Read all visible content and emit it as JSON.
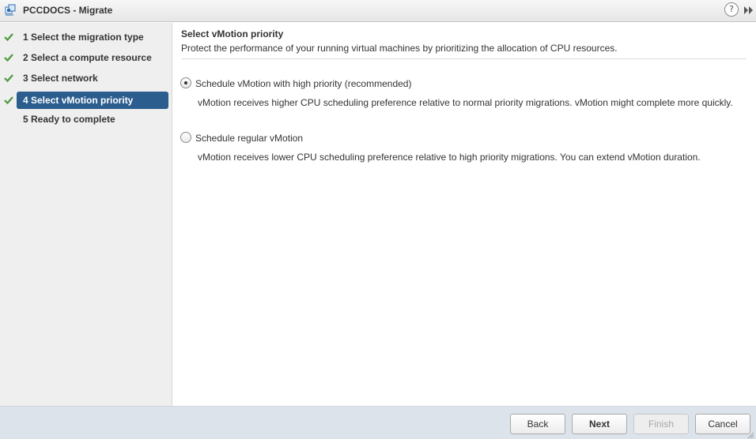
{
  "window": {
    "title": "PCCDOCS - Migrate",
    "help_glyph": "?",
    "icons": {
      "app": "vm-migrate-icon",
      "help": "help-icon",
      "expand": "expand-icon"
    }
  },
  "colors": {
    "active_step": "#2b5d8e",
    "check": "#4a9a3b",
    "footer": "#dde3ea",
    "sidebar": "#efefef"
  },
  "steps": [
    {
      "label": "1  Select the migration type",
      "completed": true,
      "active": false
    },
    {
      "label": "2  Select a compute resource",
      "completed": true,
      "active": false
    },
    {
      "label": "3  Select network",
      "completed": true,
      "active": false
    },
    {
      "label": "4  Select vMotion priority",
      "completed": true,
      "active": true
    },
    {
      "label": "5  Ready to complete",
      "completed": false,
      "active": false
    }
  ],
  "section": {
    "title": "Select vMotion priority",
    "description": "Protect the performance of your running virtual machines by prioritizing the allocation of CPU resources."
  },
  "options": [
    {
      "label": "Schedule vMotion with high priority (recommended)",
      "description": "vMotion receives higher CPU scheduling preference relative to normal priority migrations. vMotion might complete more quickly.",
      "selected": true
    },
    {
      "label": "Schedule regular vMotion",
      "description": "vMotion receives lower CPU scheduling preference relative to high priority migrations. You can extend vMotion duration.",
      "selected": false
    }
  ],
  "buttons": {
    "back": "Back",
    "next": "Next",
    "finish": "Finish",
    "cancel": "Cancel"
  }
}
